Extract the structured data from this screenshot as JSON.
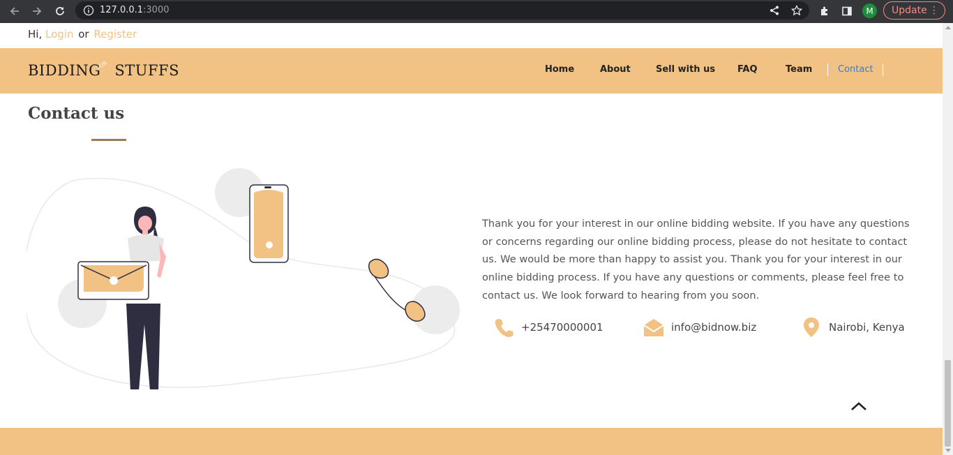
{
  "browser": {
    "url_host": "127.0.0.1",
    "url_port": ":3000",
    "avatar_letter": "M",
    "update_label": "Update",
    "menu_glyph": "⋮"
  },
  "topbar": {
    "greeting": "Hi,",
    "login": "Login",
    "or": "or",
    "register": "Register"
  },
  "brand": {
    "word1": "BIDDING",
    "small": "FOR",
    "word2": "STUFFS"
  },
  "nav": {
    "items": [
      {
        "label": "Home"
      },
      {
        "label": "About"
      },
      {
        "label": "Sell with us"
      },
      {
        "label": "FAQ"
      },
      {
        "label": "Team"
      },
      {
        "label": "Contact"
      }
    ]
  },
  "contact": {
    "title": "Contact us",
    "text": "Thank you for your interest in our online bidding website. If you have any questions or concerns regarding our online bidding process, please do not hesitate to contact us. We would be more than happy to assist you. Thank you for your interest in our online bidding process. If you have any questions or comments, please feel free to contact us. We look forward to hearing from you soon.",
    "phone": "+25470000001",
    "email": "info@bidnow.biz",
    "location": "Nairobi, Kenya"
  },
  "colors": {
    "accent": "#f1c283",
    "active_link": "#2f7fd8",
    "title_line": "#a07a53"
  }
}
